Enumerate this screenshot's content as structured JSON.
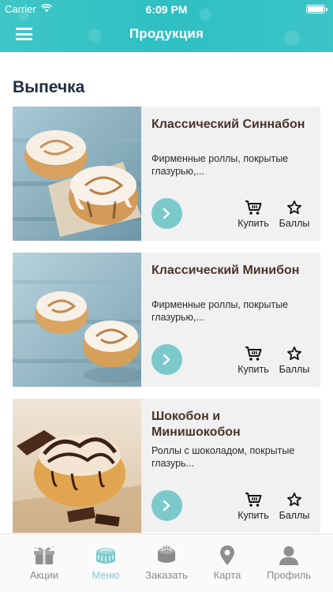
{
  "status_bar": {
    "carrier": "Carrier",
    "time": "6:09 PM"
  },
  "header": {
    "title": "Продукция"
  },
  "section": {
    "title": "Выпечка"
  },
  "products": [
    {
      "title": "Классический Синнабон",
      "description": "Фирменные роллы, покрытые глазурью,...",
      "buy_label": "Купить",
      "points_label": "Баллы"
    },
    {
      "title": "Классический Минибон",
      "description": "Фирменные роллы, покрытые глазурью,...",
      "buy_label": "Купить",
      "points_label": "Баллы"
    },
    {
      "title": "Шокобон и Минишокобон",
      "description": "Роллы с шоколадом, покрытые глазурь...",
      "buy_label": "Купить",
      "points_label": "Баллы"
    }
  ],
  "tabbar": {
    "items": [
      {
        "label": "Акции",
        "icon": "gift-icon"
      },
      {
        "label": "Меню",
        "icon": "cake-icon"
      },
      {
        "label": "Заказать",
        "icon": "order-icon"
      },
      {
        "label": "Карта",
        "icon": "map-pin-icon"
      },
      {
        "label": "Профиль",
        "icon": "profile-icon"
      }
    ],
    "active_index": 1
  },
  "colors": {
    "header": "#2ec0c3",
    "accent": "#7cc9cc",
    "title_text": "#1f2b40",
    "product_title": "#4a3329",
    "card_bg": "#f1f1f1"
  }
}
